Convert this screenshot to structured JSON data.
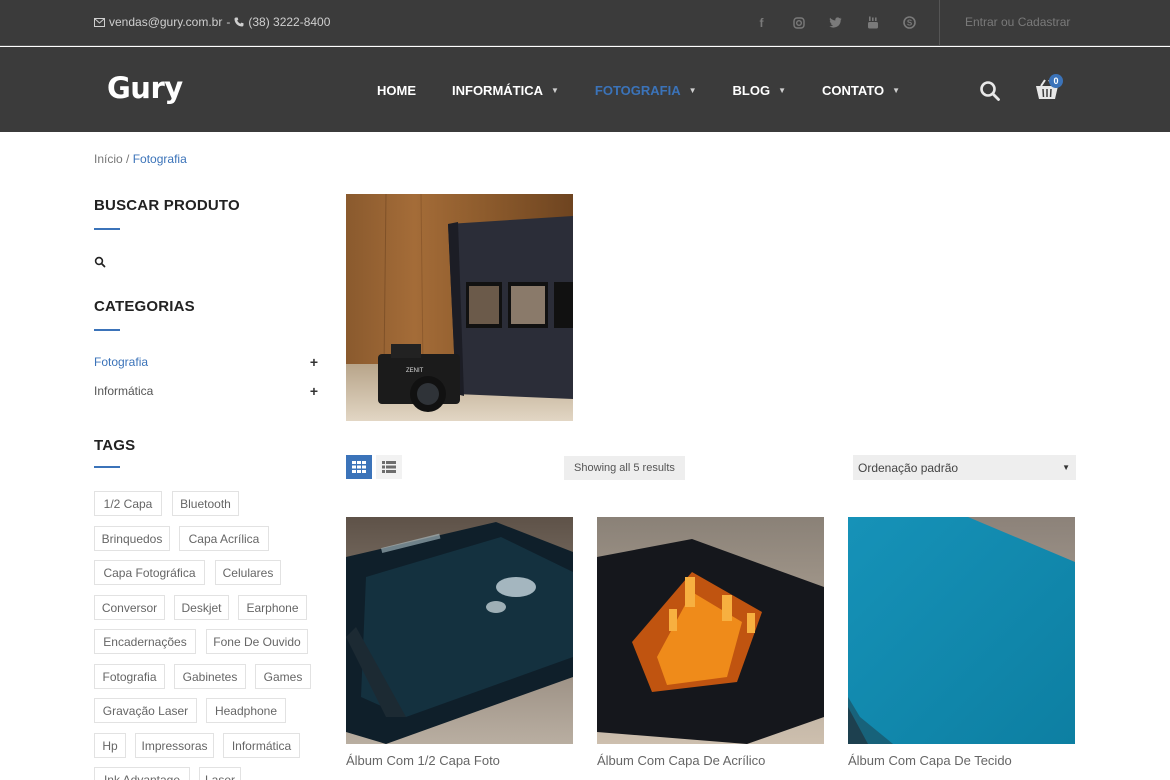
{
  "topbar": {
    "email": "vendas@gury.com.br",
    "separator": "-",
    "phone": "(38) 3222-8400",
    "social_icons": [
      "facebook-icon",
      "instagram-icon",
      "twitter-icon",
      "youtube-icon",
      "skype-icon"
    ],
    "login_label": "Entrar ou Cadastrar"
  },
  "header": {
    "logo": "Gury",
    "nav": [
      {
        "label": "HOME",
        "has_dropdown": false,
        "active": false
      },
      {
        "label": "INFORMÁTICA",
        "has_dropdown": true,
        "active": false
      },
      {
        "label": "FOTOGRAFIA",
        "has_dropdown": true,
        "active": true
      },
      {
        "label": "BLOG",
        "has_dropdown": true,
        "active": false
      },
      {
        "label": "CONTATO",
        "has_dropdown": true,
        "active": false
      }
    ],
    "cart_count": "0",
    "accent_color": "#3b73b9"
  },
  "breadcrumb": {
    "home": "Início",
    "separator": "/",
    "current": "Fotografia"
  },
  "sidebar": {
    "search_title": "BUSCAR PRODUTO",
    "categories_title": "CATEGORIAS",
    "categories": [
      {
        "label": "Fotografia",
        "active": true
      },
      {
        "label": "Informática",
        "active": false
      }
    ],
    "tags_title": "TAGS",
    "tags": [
      "1/2 Capa",
      "Bluetooth",
      "Brinquedos",
      "Capa Acrílica",
      "Capa Fotográfica",
      "Celulares",
      "Conversor",
      "Deskjet",
      "Earphone",
      "Encadernações",
      "Fone De Ouvido",
      "Fotografia",
      "Gabinetes",
      "Games",
      "Gravação Laser",
      "Headphone",
      "Hp",
      "Impressoras",
      "Informática",
      "Ink Advantage",
      "Laser"
    ]
  },
  "main": {
    "results_text": "Showing all 5 results",
    "sort_selected": "Ordenação padrão",
    "products": [
      {
        "title": "Álbum Com 1/2 Capa Foto"
      },
      {
        "title": "Álbum Com Capa De Acrílico"
      },
      {
        "title": "Álbum Com Capa De Tecido"
      }
    ]
  }
}
